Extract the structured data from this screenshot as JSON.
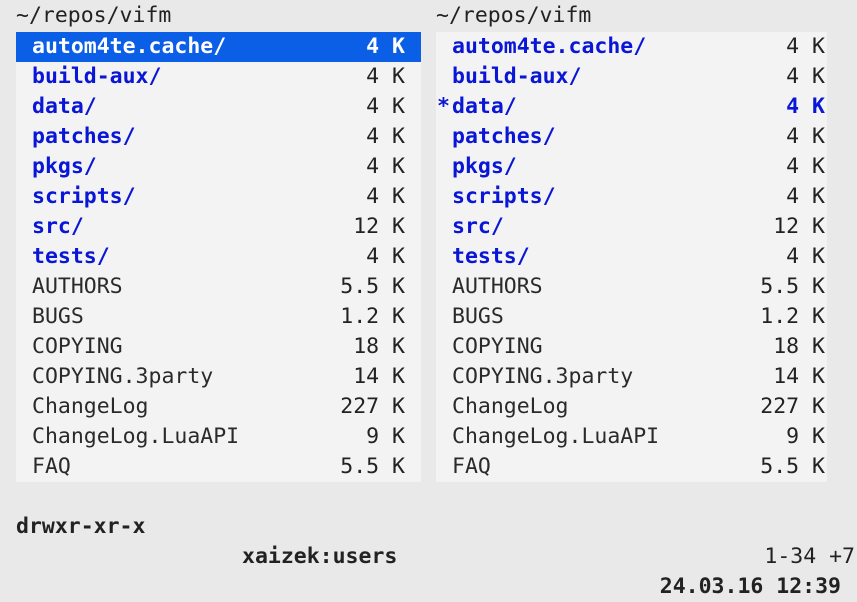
{
  "left": {
    "path": "~/repos/vifm",
    "entries": [
      {
        "name": "autom4te.cache/",
        "size": "4 K",
        "type": "dir",
        "cursor": true
      },
      {
        "name": "build-aux/",
        "size": "4 K",
        "type": "dir"
      },
      {
        "name": "data/",
        "size": "4 K",
        "type": "dir"
      },
      {
        "name": "patches/",
        "size": "4 K",
        "type": "dir"
      },
      {
        "name": "pkgs/",
        "size": "4 K",
        "type": "dir"
      },
      {
        "name": "scripts/",
        "size": "4 K",
        "type": "dir"
      },
      {
        "name": "src/",
        "size": "12 K",
        "type": "dir"
      },
      {
        "name": "tests/",
        "size": "4 K",
        "type": "dir"
      },
      {
        "name": "AUTHORS",
        "size": "5.5 K",
        "type": "file"
      },
      {
        "name": "BUGS",
        "size": "1.2 K",
        "type": "file"
      },
      {
        "name": "COPYING",
        "size": "18 K",
        "type": "file"
      },
      {
        "name": "COPYING.3party",
        "size": "14 K",
        "type": "file"
      },
      {
        "name": "ChangeLog",
        "size": "227 K",
        "type": "file"
      },
      {
        "name": "ChangeLog.LuaAPI",
        "size": "9 K",
        "type": "file"
      },
      {
        "name": "FAQ",
        "size": "5.5 K",
        "type": "file"
      }
    ]
  },
  "right": {
    "path": "~/repos/vifm",
    "entries": [
      {
        "name": "autom4te.cache/",
        "size": "4 K",
        "type": "dir"
      },
      {
        "name": "build-aux/",
        "size": "4 K",
        "type": "dir"
      },
      {
        "name": "data/",
        "size": "4 K",
        "type": "dir",
        "selected": true,
        "mark": "*"
      },
      {
        "name": "patches/",
        "size": "4 K",
        "type": "dir"
      },
      {
        "name": "pkgs/",
        "size": "4 K",
        "type": "dir"
      },
      {
        "name": "scripts/",
        "size": "4 K",
        "type": "dir"
      },
      {
        "name": "src/",
        "size": "12 K",
        "type": "dir"
      },
      {
        "name": "tests/",
        "size": "4 K",
        "type": "dir"
      },
      {
        "name": "AUTHORS",
        "size": "5.5 K",
        "type": "file"
      },
      {
        "name": "BUGS",
        "size": "1.2 K",
        "type": "file"
      },
      {
        "name": "COPYING",
        "size": "18 K",
        "type": "file"
      },
      {
        "name": "COPYING.3party",
        "size": "14 K",
        "type": "file"
      },
      {
        "name": "ChangeLog",
        "size": "227 K",
        "type": "file"
      },
      {
        "name": "ChangeLog.LuaAPI",
        "size": "9 K",
        "type": "file"
      },
      {
        "name": "FAQ",
        "size": "5.5 K",
        "type": "file"
      }
    ]
  },
  "status": {
    "permissions": "drwxr-xr-x",
    "owner": "xaizek:users",
    "datetime": "24.03.16 12:39"
  },
  "cmdline": {
    "position": "1-34 +7"
  },
  "colors": {
    "cursor_bg": "#0b5ee6",
    "dir_fg": "#0a16d6",
    "pane_bg": "#f3f3f3",
    "frame_bg": "#e9e9e9"
  }
}
